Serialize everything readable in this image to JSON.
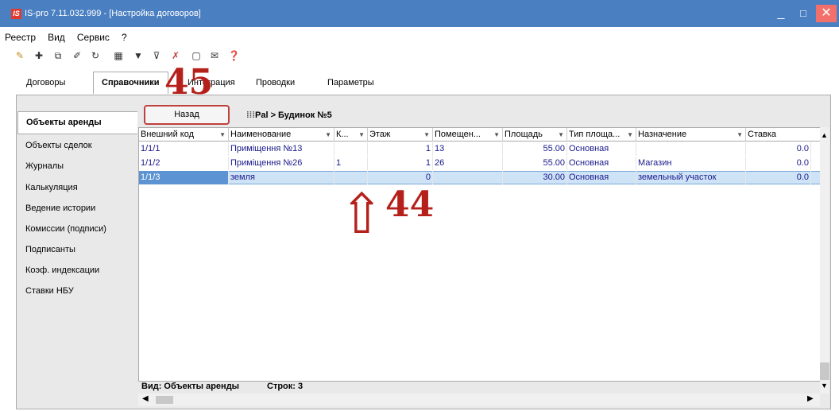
{
  "window": {
    "title": "IS-pro 7.11.032.999 - [Настройка договоров]",
    "logo": "IS",
    "min": "_",
    "max": "□",
    "close": "✕"
  },
  "menu": [
    "Реестр",
    "Вид",
    "Сервис",
    "?"
  ],
  "toolbar": [
    "add-icon",
    "add-icon",
    "copy-icon",
    "edit-icon",
    "refresh-icon",
    "table-icon",
    "filter-icon",
    "filter-clear-icon",
    "filter-remove-icon",
    "calendar-icon",
    "mail-icon",
    "help-icon"
  ],
  "tabs": [
    "Договоры",
    "Справочники",
    "Интеграция",
    "Проводки",
    "Параметры"
  ],
  "sidebar": [
    "Объекты аренды",
    "Объекты сделок",
    "Журналы",
    "Калькуляция",
    "Ведение истории",
    "Комиссии (подписи)",
    "Подписанты",
    "Коэф. индексации",
    "Ставки НБУ"
  ],
  "back_button": "Назад",
  "breadcrumb": "Pal > Будинок №5",
  "columns": [
    "Внешний код",
    "Наименование",
    "К...",
    "Этаж",
    "Помещен...",
    "Площадь",
    "Тип площа...",
    "Назначение",
    "Ставка"
  ],
  "rows": [
    [
      "1/1/1",
      "Приміщення №13",
      "",
      "1",
      "13",
      "55.00",
      "Основная",
      "",
      "0.0"
    ],
    [
      "1/1/2",
      "Приміщення №26",
      "1",
      "1",
      "26",
      "55.00",
      "Основная",
      "Магазин",
      "0.0"
    ],
    [
      "1/1/3",
      "земля",
      "",
      "0",
      "",
      "30.00",
      "Основная",
      "земельный участок",
      "0.0"
    ]
  ],
  "footer": {
    "view": "Вид: Объекты аренды",
    "rows": "Строк: 3"
  },
  "annotations": {
    "n45": "45",
    "n44": "44",
    "arrow": "⇧"
  },
  "colors": {
    "titlebar": "#4a7fc1",
    "accent_red": "#b5201b",
    "selected_row": "#cfe3f7"
  }
}
